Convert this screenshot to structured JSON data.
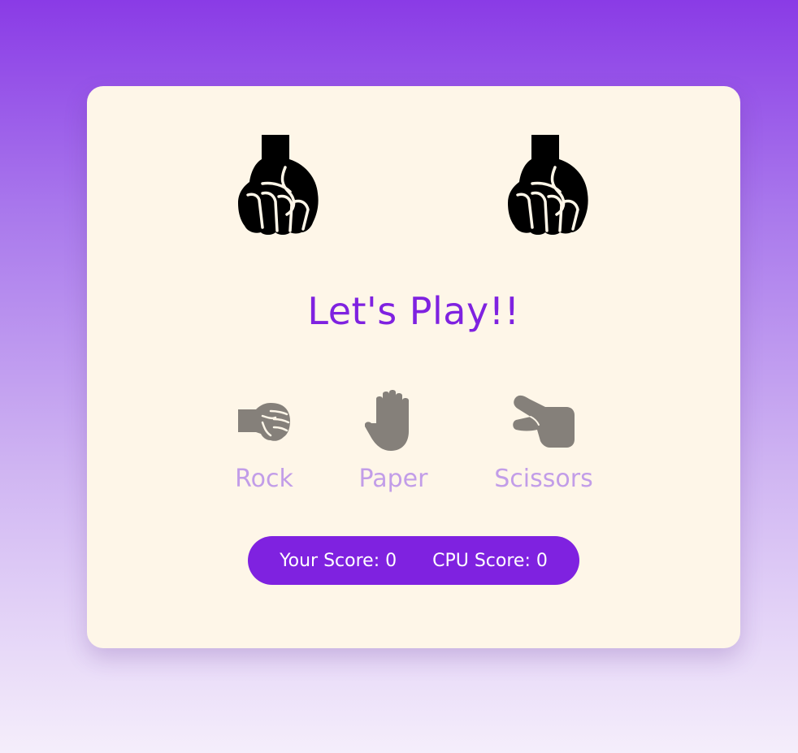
{
  "result_text": "Let's Play!!",
  "hands": {
    "player": {
      "icon": "fist-icon"
    },
    "cpu": {
      "icon": "fist-icon"
    }
  },
  "choices": [
    {
      "label": "Rock",
      "icon": "rock-fist-icon"
    },
    {
      "label": "Paper",
      "icon": "open-hand-icon"
    },
    {
      "label": "Scissors",
      "icon": "peace-hand-icon"
    }
  ],
  "score": {
    "player_label": "Your Score: 0",
    "cpu_label": "CPU Score: 0"
  },
  "colors": {
    "accent": "#7f22e0",
    "choice_label": "#c29de8",
    "choice_icon": "#85807a",
    "card": "#fef6e8"
  }
}
